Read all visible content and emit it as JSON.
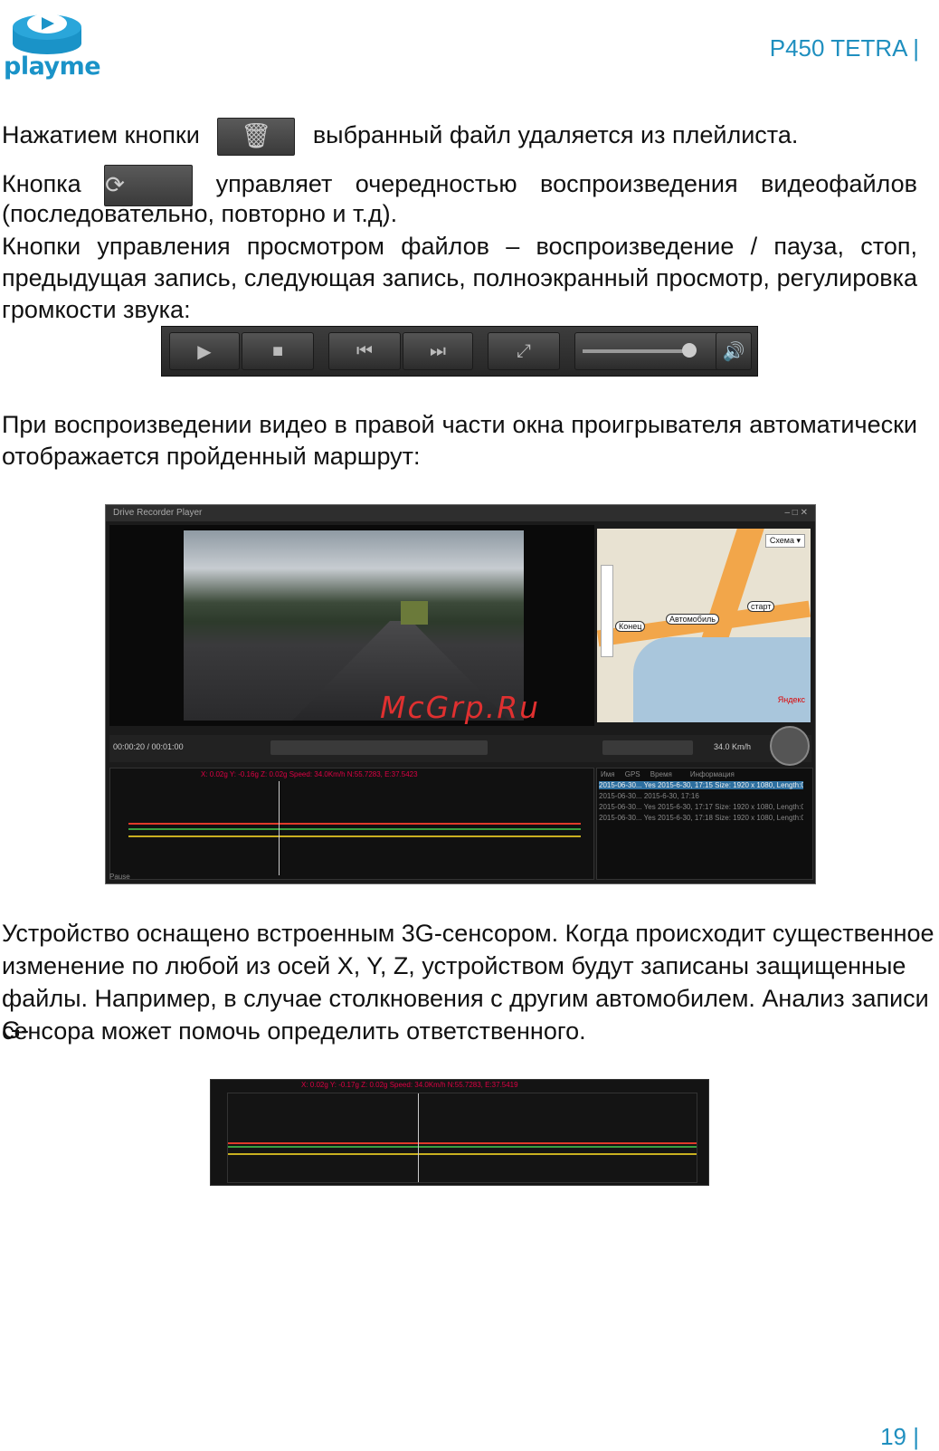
{
  "header": {
    "logo_text": "playme",
    "model": "P450 TETRA |"
  },
  "content": {
    "p1_a": "Нажатием кнопки",
    "p1_b": "выбранный файл удаляется из плейлиста.",
    "p2_a": "Кнопка",
    "p2_b": "управляет очередностью воспроизведения видеофайлов",
    "p2_c": "(последовательно, повторно и т.д).",
    "p3_l1": "Кнопки управления просмотром файлов – воспроизведение / пауза, стоп,",
    "p3_l2": "предыдущая запись, следующая запись, полноэкранный просмотр, регулировка",
    "p3_l3": "громкости звука:",
    "p4_l1": "При воспроизведении видео в правой части окна проигрывателя автоматически",
    "p4_l2": "отображается пройденный маршрут:",
    "p5_l1": "Устройство оснащено встроенным 3G-сенсором. Когда происходит существенное",
    "p5_l2": "изменение по любой из осей X, Y, Z, устройством будут записаны защищенные",
    "p5_l3": "файлы. Например, в случае столкновения с другим автомобилем. Анализ записи G-",
    "p5_l4": "сенсора может помочь определить ответственного."
  },
  "player": {
    "title": "Drive Recorder Player",
    "time": "00:00:20 / 00:01:00",
    "speed": "34.0 Km/h",
    "map_scheme": "Схема ▾",
    "map_start": "старт",
    "map_end": "Конец",
    "map_car": "Автомобиль",
    "map_logo": "Яндекс",
    "status": "Pause",
    "graph_header": "X: 0.02g   Y: -0.16g   Z: 0.02g   Speed: 34.0Km/h  N:55.7283, E:37.5423",
    "list_headers": [
      "Имя",
      "GPS",
      "Время",
      "Информация"
    ],
    "list_rows": [
      [
        "2015-06-30...",
        "Yes",
        "2015-6-30, 17:15",
        "Size: 1920 x 1080, Length:00:"
      ],
      [
        "2015-06-30...",
        "",
        "2015-6-30, 17:16",
        ""
      ],
      [
        "2015-06-30...",
        "Yes",
        "2015-6-30, 17:17",
        "Size: 1920 x 1080, Length:00:"
      ],
      [
        "2015-06-30...",
        "Yes",
        "2015-6-30, 17:18",
        "Size: 1920 x 1080, Length:00:"
      ]
    ]
  },
  "watermark": "McGrp.Ru",
  "graph2": {
    "header": "X: 0.02g   Y: -0.17g   Z: 0.02g   Speed: 34.0Km/h  N:55.7283, E:37.5419"
  },
  "footer": {
    "page": "19 |"
  },
  "colors": {
    "accent": "#1f8fbf",
    "x_axis": "#e03a2a",
    "y_axis": "#c9b020",
    "z_axis": "#3aa040"
  }
}
